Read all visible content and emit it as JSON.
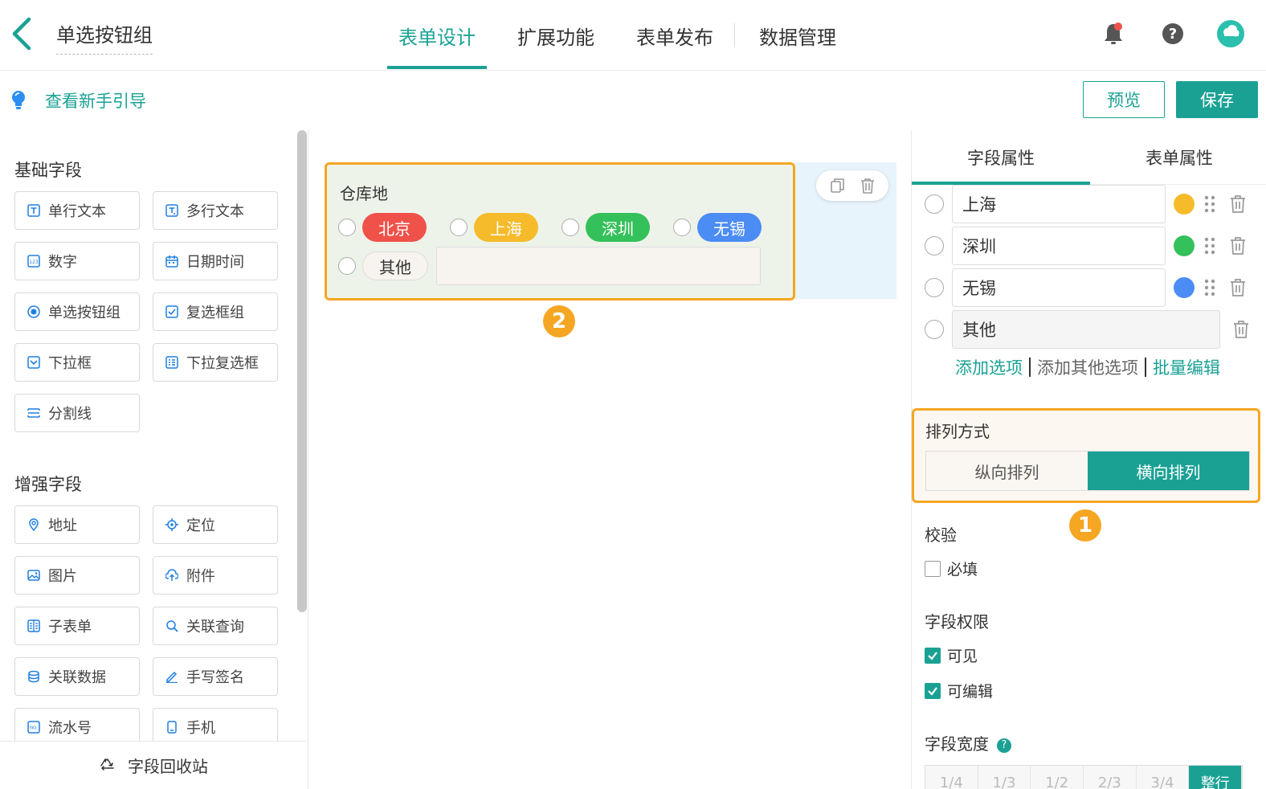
{
  "header": {
    "form_title": "单选按钮组",
    "tabs": [
      {
        "label": "表单设计",
        "active": true
      },
      {
        "label": "扩展功能",
        "active": false
      },
      {
        "label": "表单发布",
        "active": false
      },
      {
        "label": "数据管理",
        "active": false
      }
    ],
    "icons": [
      "back-arrow-icon",
      "bell-icon",
      "help-icon",
      "avatar"
    ]
  },
  "subbar": {
    "guide_label": "查看新手引导",
    "preview_label": "预览",
    "save_label": "保存"
  },
  "left_panel": {
    "basic_title": "基础字段",
    "basic_fields": [
      {
        "label": "单行文本",
        "icon": "text-icon"
      },
      {
        "label": "多行文本",
        "icon": "textarea-icon"
      },
      {
        "label": "数字",
        "icon": "number-icon"
      },
      {
        "label": "日期时间",
        "icon": "calendar-icon"
      },
      {
        "label": "单选按钮组",
        "icon": "radio-icon"
      },
      {
        "label": "复选框组",
        "icon": "checkbox-icon"
      },
      {
        "label": "下拉框",
        "icon": "select-icon"
      },
      {
        "label": "下拉复选框",
        "icon": "multiselect-icon"
      },
      {
        "label": "分割线",
        "icon": "divider-icon"
      }
    ],
    "enhanced_title": "增强字段",
    "enhanced_fields": [
      {
        "label": "地址",
        "icon": "map-pin-icon"
      },
      {
        "label": "定位",
        "icon": "locate-icon"
      },
      {
        "label": "图片",
        "icon": "image-icon"
      },
      {
        "label": "附件",
        "icon": "upload-icon"
      },
      {
        "label": "子表单",
        "icon": "subform-icon"
      },
      {
        "label": "关联查询",
        "icon": "link-search-icon"
      },
      {
        "label": "关联数据",
        "icon": "link-data-icon"
      },
      {
        "label": "手写签名",
        "icon": "pen-icon"
      },
      {
        "label": "流水号",
        "icon": "serial-no-icon"
      },
      {
        "label": "手机",
        "icon": "phone-icon"
      }
    ],
    "recycle_label": "字段回收站"
  },
  "canvas": {
    "field_label": "仓库地",
    "options": [
      {
        "label": "北京",
        "color": "#f0524a"
      },
      {
        "label": "上海",
        "color": "#f5bb2a"
      },
      {
        "label": "深圳",
        "color": "#34c05a"
      },
      {
        "label": "无锡",
        "color": "#4b8cf5"
      },
      {
        "label": "其他",
        "color": "#f7f3ef"
      }
    ],
    "badge": "2"
  },
  "right_panel": {
    "tabs": [
      {
        "label": "字段属性",
        "active": true
      },
      {
        "label": "表单属性",
        "active": false
      }
    ],
    "option_rows": [
      {
        "value": "上海",
        "color": "#f5bb2a"
      },
      {
        "value": "深圳",
        "color": "#34c05a"
      },
      {
        "value": "无锡",
        "color": "#4b8cf5"
      },
      {
        "value": "其他",
        "color": ""
      }
    ],
    "add_option": "添加选项",
    "add_other": "添加其他选项",
    "batch_edit": "批量编辑",
    "arrange_title": "排列方式",
    "arrange_vertical": "纵向排列",
    "arrange_horizontal": "横向排列",
    "badge": "1",
    "validation_title": "校验",
    "required_label": "必填",
    "required_checked": false,
    "permission_title": "字段权限",
    "visible_label": "可见",
    "visible_checked": true,
    "editable_label": "可编辑",
    "editable_checked": true,
    "width_title": "字段宽度",
    "width_help": "?",
    "width_options": [
      "1/4",
      "1/3",
      "1/2",
      "2/3",
      "3/4",
      "整行"
    ],
    "width_selected": "整行"
  },
  "colors": {
    "accent": "#1aa194",
    "highlight": "#f5a623"
  }
}
